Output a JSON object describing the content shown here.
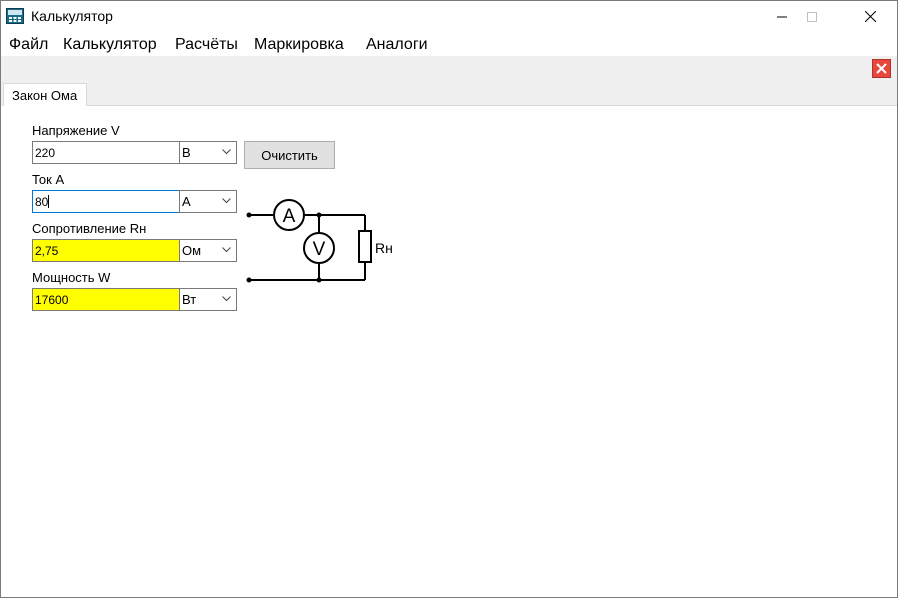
{
  "window": {
    "title": "Калькулятор",
    "icon": "calculator-app-icon"
  },
  "menu": {
    "items": [
      "Файл",
      "Калькулятор",
      "Расчёты",
      "Маркировка",
      "Аналоги"
    ]
  },
  "tabs": [
    {
      "label": "Закон Ома",
      "active": true
    }
  ],
  "form": {
    "voltage": {
      "label": "Напряжение V",
      "value": "220",
      "unit": "В"
    },
    "current": {
      "label": "Ток А",
      "value": "80",
      "unit": "А"
    },
    "resistance": {
      "label": "Сопротивление Rн",
      "value": "2,75",
      "unit": "Ом"
    },
    "power": {
      "label": "Мощность W",
      "value": "17600",
      "unit": "Вт"
    },
    "clear_label": "Очистить"
  },
  "circuit": {
    "ammeter_label": "A",
    "voltmeter_label": "V",
    "resistor_label": "Rн"
  },
  "colors": {
    "computed_field": "#ffff00",
    "close_tab": "#e8473b",
    "active_border": "#0078d7"
  }
}
